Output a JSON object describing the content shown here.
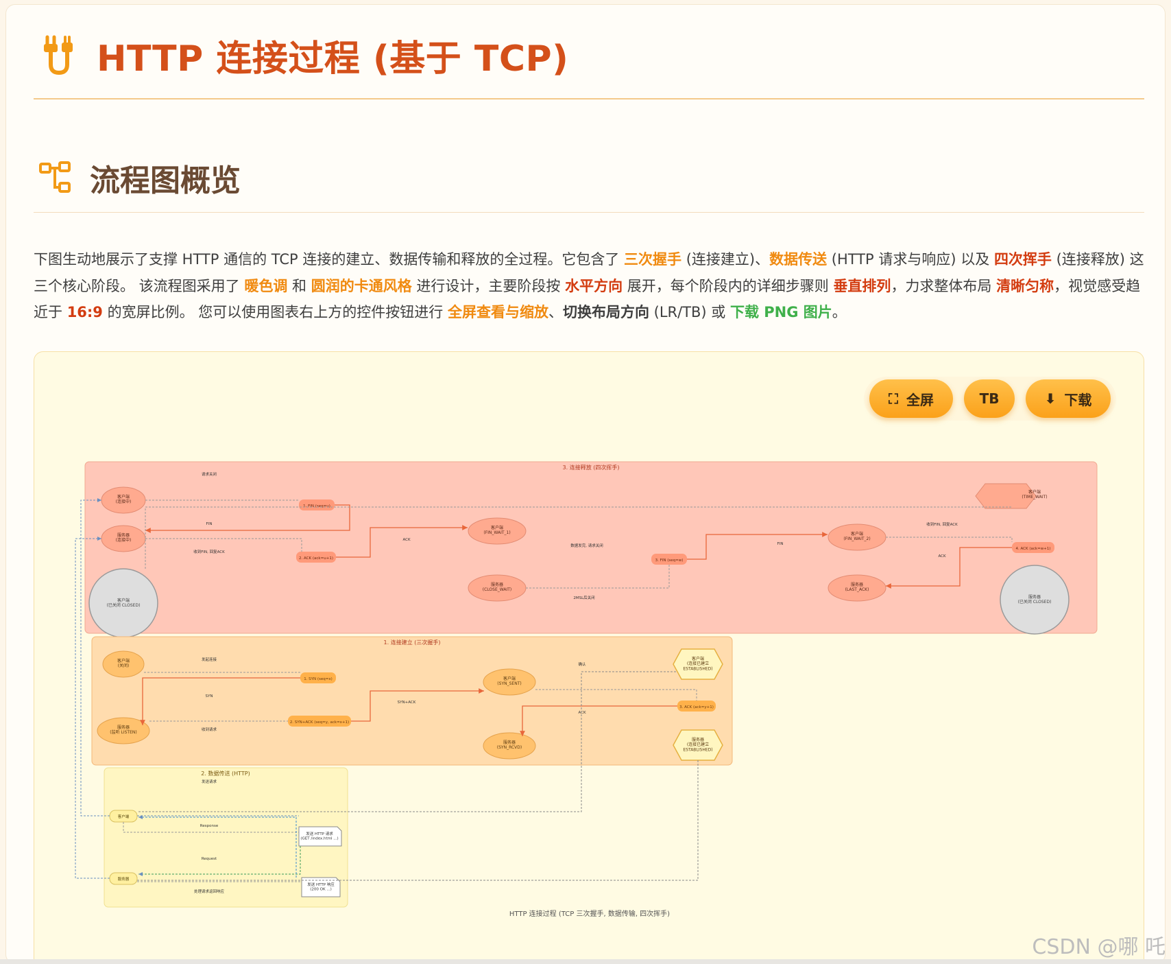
{
  "header": {
    "title": "HTTP 连接过程 (基于 TCP)",
    "icon": "plug-icon"
  },
  "overview": {
    "heading": "流程图概览",
    "icon": "flowchart-icon"
  },
  "intro": {
    "p1": "下图生动地展示了支撑 HTTP 通信的 TCP 连接的建立、数据传输和释放的全过程。它包含了 ",
    "k1": "三次握手",
    "p2": " (连接建立)、",
    "k2": "数据传送",
    "p3": " (HTTP 请求与响应) 以及 ",
    "k3": "四次挥手",
    "p4": " (连接释放) 这三个核心阶段。 该流程图采用了 ",
    "k4": "暖色调",
    "p5": " 和 ",
    "k5": "圆润的卡通风格",
    "p6": " 进行设计，主要阶段按 ",
    "k6": "水平方向",
    "p7": " 展开，每个阶段内的详细步骤则 ",
    "k7": "垂直排列",
    "p8": "，力求整体布局 ",
    "k8": "清晰匀称",
    "p9": "，视觉感受趋近于 ",
    "k9": "16:9",
    "p10": " 的宽屏比例。 您可以使用图表右上方的控件按钮进行 ",
    "k10": "全屏查看与缩放",
    "p11": "、",
    "k11": "切换布局方向",
    "p12": " (LR/TB) 或 ",
    "k12": "下载 PNG 图片",
    "p13": "。"
  },
  "toolbar": {
    "fullscreen_label": "全屏",
    "layout_label": "TB",
    "download_label": "下载"
  },
  "diagram": {
    "caption": "HTTP 连接过程 (TCP 三次握手, 数据传输, 四次挥手)",
    "release": {
      "title": "3. 连接释放 (四次挥手)",
      "client_est": "客户端\n(连接中)",
      "server_est": "服务器\n(连接中)",
      "client_closed": "客户端\n(已关闭 CLOSED)",
      "server_closed": "服务器\n(已关闭 CLOSED)",
      "client_fw1": "客户端\n(FIN_WAIT_1)",
      "server_cw": "服务器\n(CLOSE_WAIT)",
      "client_fw2": "客户端\n(FIN_WAIT_2)",
      "server_la": "服务器\n(LAST_ACK)",
      "client_tw": "客户端\n(TIME_WAIT)",
      "m1": "1. FIN (seq=u)",
      "m2": "2. ACK (ack=u+1)",
      "m3": "3. FIN (seq=w)",
      "m4": "4. ACK (ack=w+1)",
      "l_fin": "FIN",
      "l_ack": "ACK",
      "l_fin2": "FIN",
      "l_ack2": "ACK",
      "t_send": "请求关闭",
      "t_recv": "收到FIN, 回复ACK",
      "t_mid": "数据发完, 请求关闭",
      "t_wait": "收到FIN, 回复ACK",
      "t_2msl": "2MSL后关闭"
    },
    "handshake": {
      "title": "1. 连接建立 (三次握手)",
      "client_closed": "客户端\n(关闭)",
      "server_listen": "服务器\n(监听 LISTEN)",
      "client_sent": "客户端\n(SYN_SENT)",
      "server_rcvd": "服务器\n(SYN_RCVD)",
      "client_est": "客户端\n(连接已建立\nESTABLISHED)",
      "server_est": "服务器\n(连接已建立\nESTABLISHED)",
      "m1": "1. SYN (seq=x)",
      "m2": "2. SYN+ACK (seq=y, ack=x+1)",
      "m3": "3. ACK (ack=y+1)",
      "l_syn": "SYN",
      "l_synack": "SYN+ACK",
      "l_ack": "ACK",
      "t_req": "发起连接",
      "t_recv": "收到请求",
      "t_ok": "确认"
    },
    "transfer": {
      "title": "2. 数据传送 (HTTP)",
      "client": "客户端",
      "server": "服务器",
      "req": "发送 HTTP 请求\n(GET /index.html ...)",
      "res": "发送 HTTP 响应\n(200 OK ...)",
      "l_response": "Response",
      "l_request": "Request",
      "t_top": "发送请求",
      "t_bottom": "处理请求返回响应"
    }
  },
  "colors": {
    "accent": "#d4501a",
    "orange": "#f08a10",
    "green": "#3fb04a",
    "release_bg": "#ffc7b8",
    "handshake_bg": "#ffdcae",
    "transfer_bg": "#fff6c2"
  },
  "watermark": "CSDN @哪 吒"
}
